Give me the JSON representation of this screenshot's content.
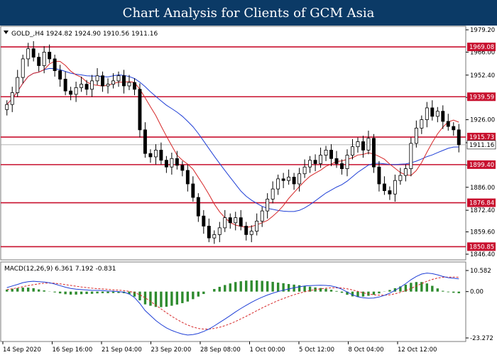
{
  "header": {
    "title": "Chart Analysis for Clients of GCM Asia"
  },
  "chart_data": [
    {
      "type": "candlestick",
      "symbol_info": "GOLD_,H4  1924.82 1924.90 1910.56 1911.16",
      "y_ticks": [
        "1979.20",
        "1966.00",
        "1952.40",
        "1939.20",
        "1926.00",
        "1912.40",
        "1899.20",
        "1886.00",
        "1872.40",
        "1859.60",
        "1846.40"
      ],
      "ylim": [
        1846.4,
        1979.2
      ],
      "grid": false,
      "x_ticks": [
        "14 Sep 2020",
        "16 Sep 16:00",
        "21 Sep 04:00",
        "23 Sep 20:00",
        "28 Sep 08:00",
        "1 Oct 00:00",
        "5 Oct 12:00",
        "8 Oct 04:00",
        "12 Oct 12:00"
      ],
      "horizontal_levels": [
        "1969.08",
        "1939.59",
        "1915.73",
        "1899.40",
        "1876.84",
        "1850.85"
      ],
      "current_price": "1911.16",
      "colors": {
        "bull": "#000000",
        "bear": "#000000",
        "ma_fast": "#d62728",
        "ma_slow": "#1f3fd6",
        "levels": "#c8102e"
      },
      "close": [
        1935,
        1942,
        1951,
        1962,
        1968,
        1963,
        1958,
        1966,
        1962,
        1955,
        1950,
        1943,
        1941,
        1945,
        1947,
        1944,
        1949,
        1952,
        1946,
        1947,
        1949,
        1952,
        1946,
        1948,
        1944,
        1920,
        1906,
        1904,
        1908,
        1902,
        1898,
        1903,
        1899,
        1896,
        1888,
        1880,
        1869,
        1863,
        1856,
        1858,
        1862,
        1868,
        1865,
        1868,
        1863,
        1858,
        1860,
        1866,
        1872,
        1879,
        1885,
        1891,
        1890,
        1892,
        1888,
        1894,
        1898,
        1902,
        1900,
        1905,
        1908,
        1903,
        1900,
        1897,
        1905,
        1910,
        1913,
        1908,
        1915,
        1898,
        1888,
        1884,
        1882,
        1890,
        1893,
        1897,
        1912,
        1921,
        1926,
        1933,
        1928,
        1931,
        1925,
        1922,
        1920,
        1911.16
      ],
      "macd": {
        "label": "MACD(12,26,9) 6.361 7.192 -0.831",
        "y_ticks": [
          "10.582",
          "0.00",
          "-23.272"
        ],
        "ylim": [
          -23.272,
          10.582
        ],
        "macd_line": [
          2.0,
          2.8,
          3.6,
          4.5,
          5.0,
          5.2,
          5.0,
          4.8,
          4.4,
          3.8,
          3.0,
          2.2,
          1.6,
          1.2,
          1.0,
          0.8,
          0.6,
          0.6,
          0.5,
          0.3,
          0.2,
          0.0,
          -0.3,
          -1.2,
          -3.0,
          -6.0,
          -9.5,
          -12.0,
          -14.5,
          -16.5,
          -18.2,
          -19.5,
          -20.5,
          -21.3,
          -21.8,
          -21.6,
          -21.0,
          -20.0,
          -18.8,
          -17.2,
          -15.5,
          -13.8,
          -12.0,
          -10.2,
          -8.5,
          -6.9,
          -5.4,
          -4.0,
          -2.8,
          -1.7,
          -0.8,
          0.0,
          0.7,
          1.3,
          1.9,
          2.4,
          2.8,
          3.0,
          3.1,
          3.2,
          3.1,
          2.8,
          2.2,
          1.2,
          -0.2,
          -1.6,
          -2.6,
          -3.1,
          -3.3,
          -3.2,
          -2.7,
          -1.9,
          -0.8,
          0.6,
          2.2,
          4.0,
          6.0,
          7.6,
          8.8,
          9.3,
          9.0,
          8.4,
          7.6,
          7.0,
          6.7,
          6.361
        ],
        "signal_line": [
          1.0,
          1.4,
          1.9,
          2.5,
          3.0,
          3.5,
          3.9,
          4.2,
          4.3,
          4.2,
          3.9,
          3.5,
          3.1,
          2.7,
          2.3,
          2.0,
          1.7,
          1.5,
          1.3,
          1.1,
          0.9,
          0.7,
          0.5,
          0.1,
          -0.5,
          -1.6,
          -3.1,
          -4.9,
          -6.8,
          -8.7,
          -10.6,
          -12.4,
          -14.0,
          -15.5,
          -16.8,
          -17.8,
          -18.5,
          -18.8,
          -18.8,
          -18.5,
          -17.9,
          -17.1,
          -16.1,
          -15.0,
          -13.7,
          -12.4,
          -11.0,
          -9.6,
          -8.2,
          -6.9,
          -5.7,
          -4.5,
          -3.5,
          -2.5,
          -1.6,
          -0.8,
          -0.1,
          0.5,
          1.0,
          1.4,
          1.7,
          1.9,
          1.9,
          1.8,
          1.4,
          0.8,
          0.1,
          -0.6,
          -1.2,
          -1.6,
          -1.8,
          -1.8,
          -1.6,
          -1.1,
          -0.4,
          0.5,
          1.6,
          2.8,
          4.0,
          5.2,
          6.1,
          6.8,
          7.2,
          7.3,
          7.3,
          7.192
        ],
        "colors": {
          "macd": "#1f3fd6",
          "signal": "#d62728",
          "histogram": "#2e8b2e"
        }
      }
    }
  ]
}
